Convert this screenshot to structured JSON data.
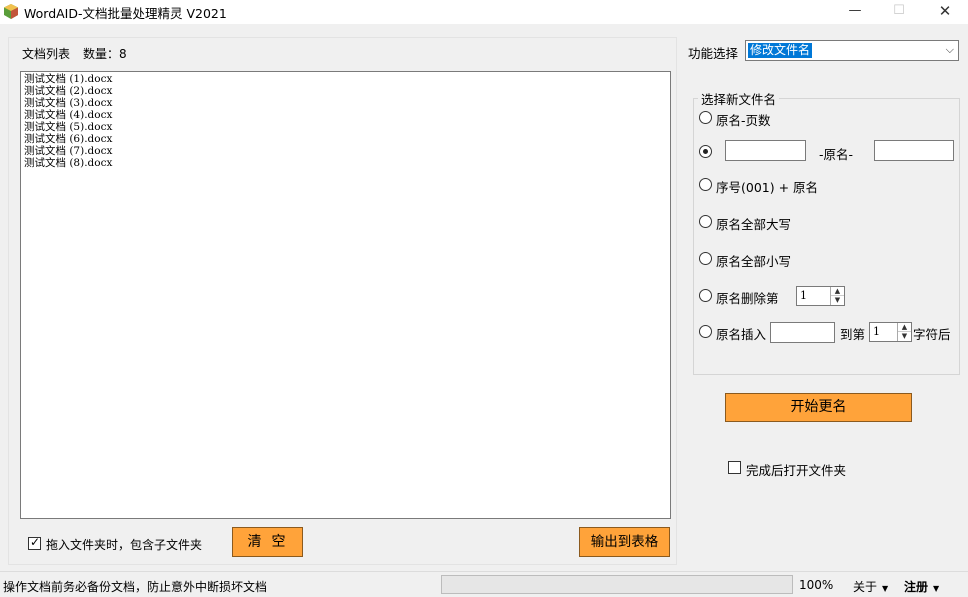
{
  "window": {
    "title": "WordAID-文档批量处理精灵 V2021",
    "minimize_glyph": "—",
    "maximize_glyph": "☐",
    "close_glyph": "✕"
  },
  "doc_list": {
    "label": "文档列表",
    "count_label": "数量：8",
    "items": [
      "测试文档 (1).docx",
      "测试文档 (2).docx",
      "测试文档 (3).docx",
      "测试文档 (4).docx",
      "测试文档 (5).docx",
      "测试文档 (6).docx",
      "测试文档 (7).docx",
      "测试文档 (8).docx"
    ]
  },
  "left_bottom": {
    "include_subfolders_label": "拖入文件夹时，包含子文件夹",
    "include_subfolders_checked": true,
    "clear_button": "清空",
    "export_button": "输出到表格"
  },
  "function": {
    "label": "功能选择",
    "selected": "修改文件名"
  },
  "rename": {
    "group_title": "选择新文件名",
    "opt_page_count": "原名-页数",
    "opt_prefix_suffix_middle": "-原名-",
    "opt_serial": "序号(001) + 原名",
    "opt_upper": "原名全部大写",
    "opt_lower": "原名全部小写",
    "opt_delete_label": "原名删除第",
    "opt_delete_value": "1",
    "opt_insert_label": "原名插入",
    "opt_insert_to": "到第",
    "opt_insert_value": "1",
    "opt_insert_after": "字符后",
    "selected_option": "prefix_suffix"
  },
  "actions": {
    "start_button": "开始更名",
    "open_folder_label": "完成后打开文件夹",
    "open_folder_checked": false
  },
  "status": {
    "text": "操作文档前务必备份文档，防止意外中断损坏文档",
    "zoom": "100%",
    "about": "关于",
    "register": "注册"
  },
  "colors": {
    "accent_button": "#ffa33a",
    "selection": "#0078d7"
  }
}
